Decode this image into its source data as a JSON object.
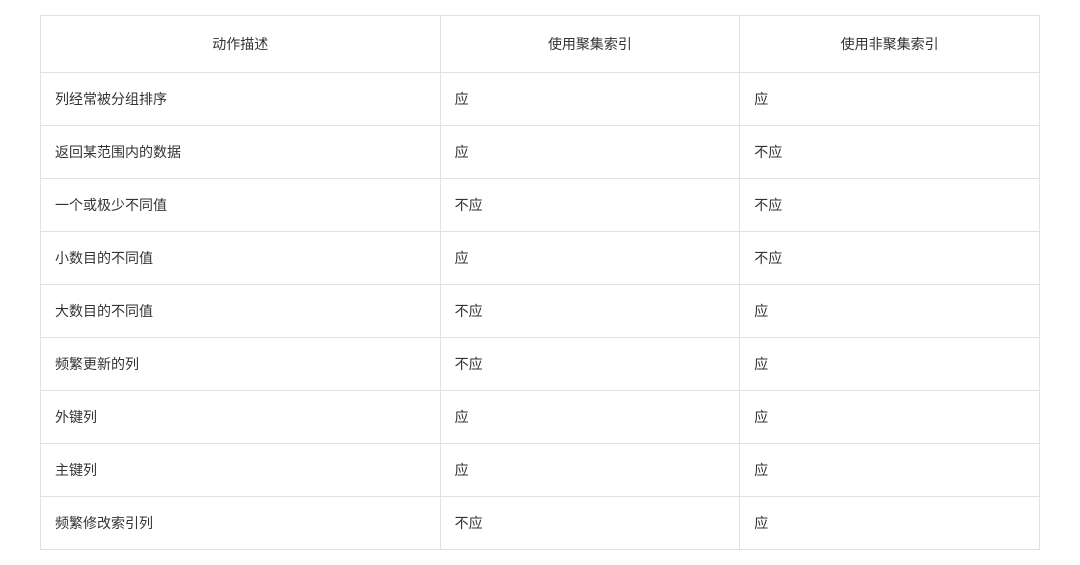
{
  "chart_data": {
    "type": "table",
    "headers": [
      "动作描述",
      "使用聚集索引",
      "使用非聚集索引"
    ],
    "rows": [
      [
        "列经常被分组排序",
        "应",
        "应"
      ],
      [
        "返回某范围内的数据",
        "应",
        "不应"
      ],
      [
        "一个或极少不同值",
        "不应",
        "不应"
      ],
      [
        "小数目的不同值",
        "应",
        "不应"
      ],
      [
        "大数目的不同值",
        "不应",
        "应"
      ],
      [
        "频繁更新的列",
        "不应",
        "应"
      ],
      [
        "外键列",
        "应",
        "应"
      ],
      [
        "主键列",
        "应",
        "应"
      ],
      [
        "频繁修改索引列",
        "不应",
        "应"
      ]
    ]
  }
}
